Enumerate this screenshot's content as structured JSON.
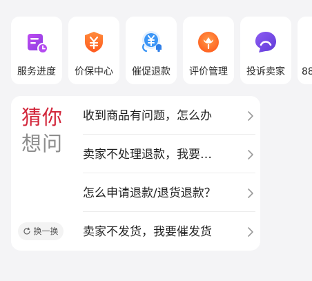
{
  "services": [
    {
      "label": "服务进度",
      "icon": "schedule-icon",
      "color": "#a046e6"
    },
    {
      "label": "价保中心",
      "icon": "price-shield-icon",
      "color": "#ff6a22"
    },
    {
      "label": "催促退款",
      "icon": "refund-bell-icon",
      "color": "#2f8cf4"
    },
    {
      "label": "评价管理",
      "icon": "flower-badge-icon",
      "color": "#ff6a22"
    },
    {
      "label": "投诉卖家",
      "icon": "complaint-face-icon",
      "color": "#7b4de8"
    },
    {
      "label": "88",
      "icon": "partial-tile-icon",
      "color": "#888888"
    }
  ],
  "guess": {
    "title_line1": "猜你",
    "title_line2": "想问",
    "title_color": "#d2253a",
    "refresh_label": "换一换",
    "questions": [
      "收到商品有问题，怎么办",
      "卖家不处理退款，我要…",
      "怎么申请退款/退货退款？",
      "卖家不发货，我要催发货"
    ]
  }
}
